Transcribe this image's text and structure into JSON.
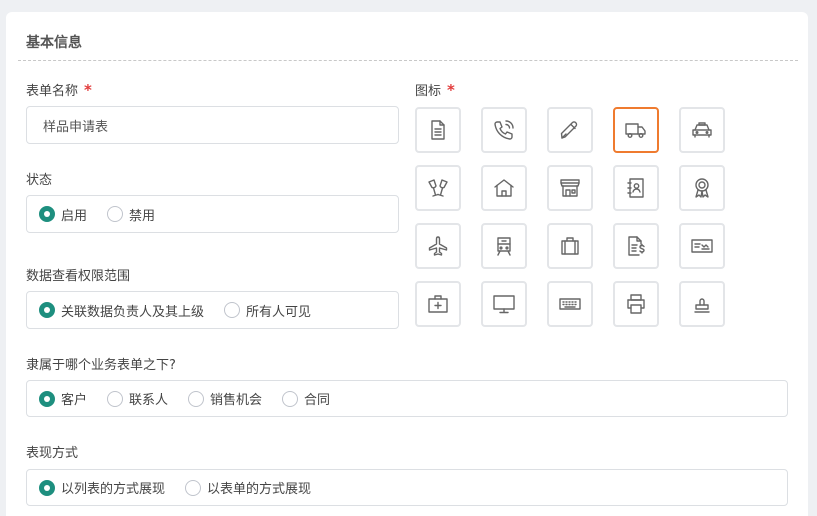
{
  "section": {
    "title": "基本信息"
  },
  "form_name": {
    "label": "表单名称",
    "required_mark": "*",
    "value": "样品申请表"
  },
  "icon_picker": {
    "label": "图标",
    "required_mark": "*",
    "selected": "truck-icon",
    "selected_color": "#ef7b2f",
    "icons": [
      "document-icon",
      "phone-call-icon",
      "pen-icon",
      "truck-icon",
      "taxi-icon",
      "cheers-icon",
      "home-icon",
      "store-icon",
      "contact-book-icon",
      "award-icon",
      "airplane-icon",
      "train-icon",
      "suitcase-icon",
      "invoice-icon",
      "cheque-icon",
      "medical-kit-icon",
      "monitor-icon",
      "keyboard-icon",
      "printer-icon",
      "stamp-icon"
    ]
  },
  "status": {
    "label": "状态",
    "options": [
      {
        "label": "启用",
        "checked": true
      },
      {
        "label": "禁用",
        "checked": false
      }
    ]
  },
  "data_scope": {
    "label": "数据查看权限范围",
    "options": [
      {
        "label": "关联数据负责人及其上级",
        "checked": true
      },
      {
        "label": "所有人可见",
        "checked": false
      }
    ]
  },
  "belongs_to": {
    "label": "隶属于哪个业务表单之下?",
    "options": [
      {
        "label": "客户",
        "checked": true
      },
      {
        "label": "联系人",
        "checked": false
      },
      {
        "label": "销售机会",
        "checked": false
      },
      {
        "label": "合同",
        "checked": false
      }
    ]
  },
  "display_mode": {
    "label": "表现方式",
    "options": [
      {
        "label": "以列表的方式展现",
        "checked": true
      },
      {
        "label": "以表单的方式展现",
        "checked": false
      }
    ]
  },
  "colors": {
    "accent": "#1e8f7f",
    "required": "#e23b3b",
    "background": "#eef0f3"
  }
}
